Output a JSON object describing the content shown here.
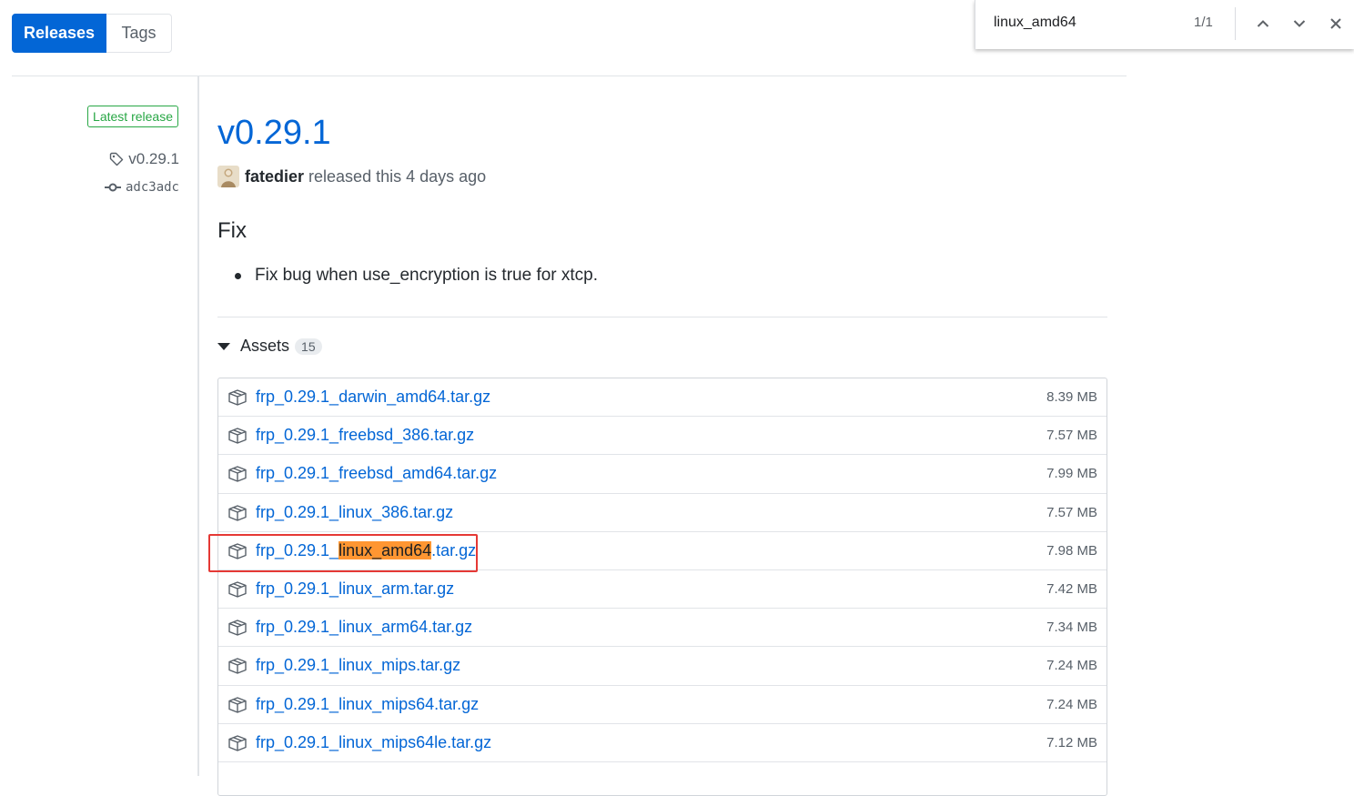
{
  "tabs": {
    "releases_label": "Releases",
    "tags_label": "Tags"
  },
  "findbar": {
    "query": "linux_amd64",
    "count": "1/1"
  },
  "sidebar": {
    "latest_badge": "Latest release",
    "tag": "v0.29.1",
    "commit": "adc3adc"
  },
  "release": {
    "title": "v0.29.1",
    "author": "fatedier",
    "released_text": "released this 4 days ago",
    "section_heading": "Fix",
    "notes": [
      "Fix bug when use_encryption is true for xtcp."
    ]
  },
  "assets": {
    "label": "Assets",
    "count": "15",
    "items": [
      {
        "name": "frp_0.29.1_darwin_amd64.tar.gz",
        "size": "8.39 MB"
      },
      {
        "name": "frp_0.29.1_freebsd_386.tar.gz",
        "size": "7.57 MB"
      },
      {
        "name": "frp_0.29.1_freebsd_amd64.tar.gz",
        "size": "7.99 MB"
      },
      {
        "name": "frp_0.29.1_linux_386.tar.gz",
        "size": "7.57 MB"
      },
      {
        "name_prefix": "frp_0.29.1_",
        "name_match": "linux_amd64",
        "name_suffix": ".tar.gz",
        "size": "7.98 MB"
      },
      {
        "name": "frp_0.29.1_linux_arm.tar.gz",
        "size": "7.42 MB"
      },
      {
        "name": "frp_0.29.1_linux_arm64.tar.gz",
        "size": "7.34 MB"
      },
      {
        "name": "frp_0.29.1_linux_mips.tar.gz",
        "size": "7.24 MB"
      },
      {
        "name": "frp_0.29.1_linux_mips64.tar.gz",
        "size": "7.24 MB"
      },
      {
        "name": "frp_0.29.1_linux_mips64le.tar.gz",
        "size": "7.12 MB"
      }
    ]
  },
  "colors": {
    "link": "#0366d6",
    "highlight": "#ff9632",
    "annotation_box": "#e53935",
    "latest_badge": "#28a745"
  }
}
